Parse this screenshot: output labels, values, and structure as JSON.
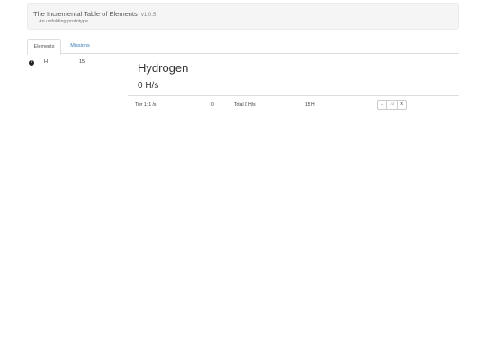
{
  "header": {
    "title": "The Incremental Table of Elements",
    "version": "v1.0.5",
    "subtitle": "An unfolding prototype"
  },
  "tabs": [
    {
      "label": "Elements",
      "active": true
    },
    {
      "label": "Missions",
      "active": false
    }
  ],
  "element_list": [
    {
      "symbol": "H",
      "count": "15",
      "info_icon": "info-icon"
    }
  ],
  "detail": {
    "name": "Hydrogen",
    "rate": "0 H/s",
    "tier": {
      "label": "Tier 1:  1 /s",
      "count": "0",
      "total": "Total 0 H/s",
      "cost": "15 H",
      "buy_buttons": [
        "1",
        "10",
        "x"
      ]
    }
  }
}
